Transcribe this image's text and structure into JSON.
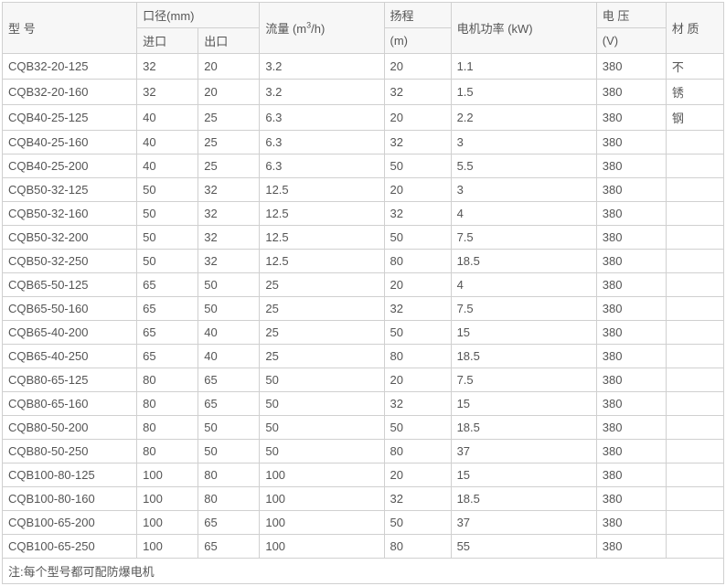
{
  "headers": {
    "model": "型  号",
    "diameter": "口径(mm)",
    "inlet": "进口",
    "outlet": "出口",
    "flow_prefix": "流量 (m",
    "flow_sup": "3",
    "flow_suffix": "/h)",
    "head_top": "扬程",
    "head_bottom": "(m)",
    "power": "电机功率 (kW)",
    "voltage_top": "电  压",
    "voltage_bottom": "(V)",
    "material": "材  质"
  },
  "material_cells": [
    "不",
    "锈",
    "钢"
  ],
  "rows": [
    {
      "model": "CQB32-20-125",
      "inlet": "32",
      "outlet": "20",
      "flow": "3.2",
      "head": "20",
      "power": "1.1",
      "voltage": "380"
    },
    {
      "model": "CQB32-20-160",
      "inlet": "32",
      "outlet": "20",
      "flow": "3.2",
      "head": "32",
      "power": "1.5",
      "voltage": "380"
    },
    {
      "model": "CQB40-25-125",
      "inlet": "40",
      "outlet": "25",
      "flow": "6.3",
      "head": "20",
      "power": "2.2",
      "voltage": "380"
    },
    {
      "model": "CQB40-25-160",
      "inlet": "40",
      "outlet": "25",
      "flow": "6.3",
      "head": "32",
      "power": "3",
      "voltage": "380"
    },
    {
      "model": "CQB40-25-200",
      "inlet": "40",
      "outlet": "25",
      "flow": "6.3",
      "head": "50",
      "power": "5.5",
      "voltage": "380"
    },
    {
      "model": "CQB50-32-125",
      "inlet": "50",
      "outlet": "32",
      "flow": "12.5",
      "head": "20",
      "power": "3",
      "voltage": "380"
    },
    {
      "model": "CQB50-32-160",
      "inlet": "50",
      "outlet": "32",
      "flow": "12.5",
      "head": "32",
      "power": "4",
      "voltage": "380"
    },
    {
      "model": "CQB50-32-200",
      "inlet": "50",
      "outlet": "32",
      "flow": "12.5",
      "head": "50",
      "power": "7.5",
      "voltage": "380"
    },
    {
      "model": "CQB50-32-250",
      "inlet": "50",
      "outlet": "32",
      "flow": "12.5",
      "head": "80",
      "power": "18.5",
      "voltage": "380"
    },
    {
      "model": "CQB65-50-125",
      "inlet": "65",
      "outlet": "50",
      "flow": "25",
      "head": "20",
      "power": "4",
      "voltage": "380"
    },
    {
      "model": "CQB65-50-160",
      "inlet": "65",
      "outlet": "50",
      "flow": "25",
      "head": "32",
      "power": "7.5",
      "voltage": "380"
    },
    {
      "model": "CQB65-40-200",
      "inlet": "65",
      "outlet": "40",
      "flow": "25",
      "head": "50",
      "power": "15",
      "voltage": "380"
    },
    {
      "model": "CQB65-40-250",
      "inlet": "65",
      "outlet": "40",
      "flow": "25",
      "head": "80",
      "power": "18.5",
      "voltage": "380"
    },
    {
      "model": "CQB80-65-125",
      "inlet": "80",
      "outlet": "65",
      "flow": "50",
      "head": "20",
      "power": "7.5",
      "voltage": "380"
    },
    {
      "model": "CQB80-65-160",
      "inlet": "80",
      "outlet": "65",
      "flow": "50",
      "head": "32",
      "power": "15",
      "voltage": "380"
    },
    {
      "model": "CQB80-50-200",
      "inlet": "80",
      "outlet": "50",
      "flow": "50",
      "head": "50",
      "power": "18.5",
      "voltage": "380"
    },
    {
      "model": "CQB80-50-250",
      "inlet": "80",
      "outlet": "50",
      "flow": "50",
      "head": "80",
      "power": "37",
      "voltage": "380"
    },
    {
      "model": "CQB100-80-125",
      "inlet": "100",
      "outlet": "80",
      "flow": "100",
      "head": "20",
      "power": "15",
      "voltage": "380"
    },
    {
      "model": "CQB100-80-160",
      "inlet": "100",
      "outlet": "80",
      "flow": "100",
      "head": "32",
      "power": "18.5",
      "voltage": "380"
    },
    {
      "model": "CQB100-65-200",
      "inlet": "100",
      "outlet": "65",
      "flow": "100",
      "head": "50",
      "power": "37",
      "voltage": "380"
    },
    {
      "model": "CQB100-65-250",
      "inlet": "100",
      "outlet": "65",
      "flow": "100",
      "head": "80",
      "power": "55",
      "voltage": "380"
    }
  ],
  "footnote": "注:每个型号都可配防爆电机"
}
